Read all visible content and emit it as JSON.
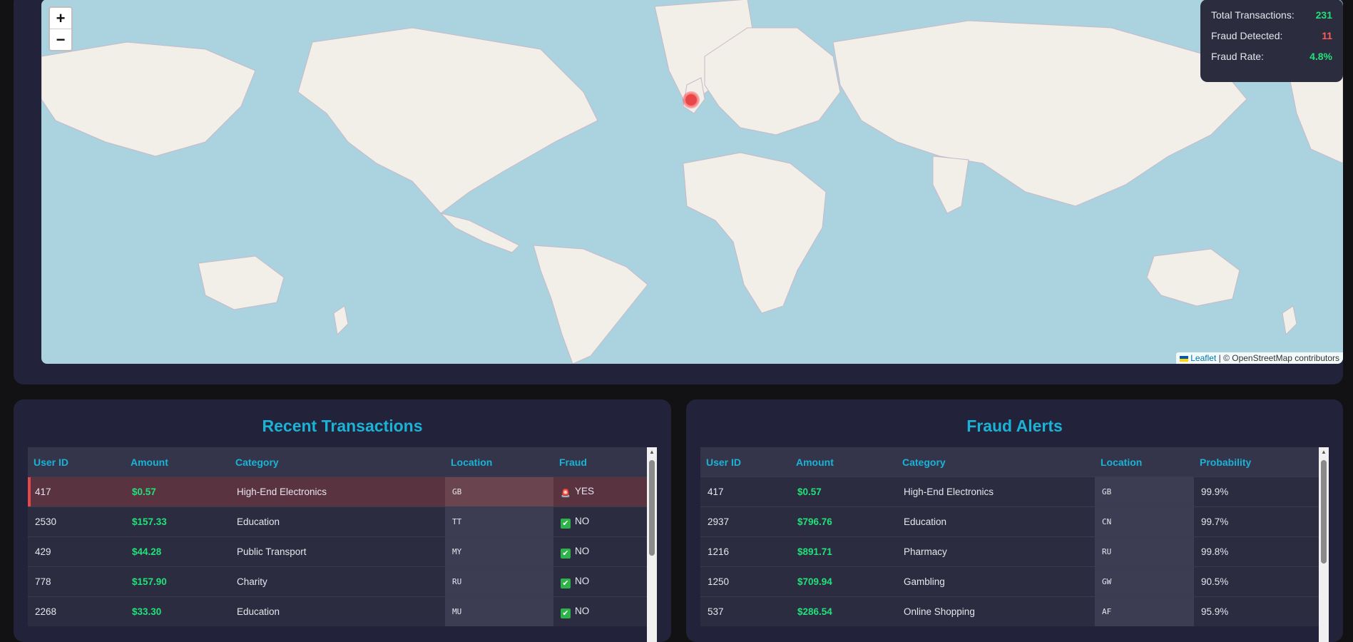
{
  "map": {
    "zoom_in": "+",
    "zoom_out": "−",
    "attribution_leaflet": "Leaflet",
    "attribution_rest": "| © OpenStreetMap contributors",
    "stats": {
      "total_label": "Total Transactions:",
      "total_value": "231",
      "fraud_label": "Fraud Detected:",
      "fraud_value": "11",
      "rate_label": "Fraud Rate:",
      "rate_value": "4.8%"
    },
    "colors": {
      "water": "#aad3df",
      "land": "#f2efe9",
      "marker": "#e8474a"
    }
  },
  "recent": {
    "title": "Recent Transactions",
    "columns": [
      "User ID",
      "Amount",
      "Category",
      "Location",
      "Fraud"
    ],
    "rows": [
      {
        "user": "417",
        "amount": "$0.57",
        "category": "High-End Electronics",
        "location": "GB",
        "fraud": "YES",
        "is_fraud": true
      },
      {
        "user": "2530",
        "amount": "$157.33",
        "category": "Education",
        "location": "TT",
        "fraud": "NO",
        "is_fraud": false
      },
      {
        "user": "429",
        "amount": "$44.28",
        "category": "Public Transport",
        "location": "MY",
        "fraud": "NO",
        "is_fraud": false
      },
      {
        "user": "778",
        "amount": "$157.90",
        "category": "Charity",
        "location": "RU",
        "fraud": "NO",
        "is_fraud": false
      },
      {
        "user": "2268",
        "amount": "$33.30",
        "category": "Education",
        "location": "MU",
        "fraud": "NO",
        "is_fraud": false
      }
    ]
  },
  "alerts": {
    "title": "Fraud Alerts",
    "columns": [
      "User ID",
      "Amount",
      "Category",
      "Location",
      "Probability"
    ],
    "rows": [
      {
        "user": "417",
        "amount": "$0.57",
        "category": "High-End Electronics",
        "location": "GB",
        "prob": "99.9%"
      },
      {
        "user": "2937",
        "amount": "$796.76",
        "category": "Education",
        "location": "CN",
        "prob": "99.7%"
      },
      {
        "user": "1216",
        "amount": "$891.71",
        "category": "Pharmacy",
        "location": "RU",
        "prob": "99.8%"
      },
      {
        "user": "1250",
        "amount": "$709.94",
        "category": "Gambling",
        "location": "GW",
        "prob": "90.5%"
      },
      {
        "user": "537",
        "amount": "$286.54",
        "category": "Online Shopping",
        "location": "AF",
        "prob": "95.9%"
      }
    ]
  }
}
